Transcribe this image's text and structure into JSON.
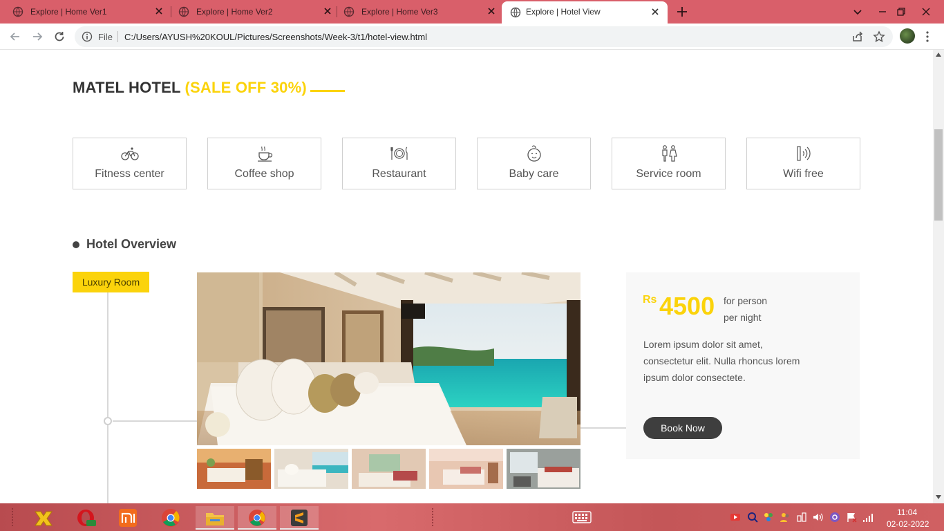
{
  "browser": {
    "tabs": [
      {
        "title": "Explore | Home Ver1",
        "active": false
      },
      {
        "title": "Explore | Home Ver2",
        "active": false
      },
      {
        "title": "Explore | Home Ver3",
        "active": false
      },
      {
        "title": "Explore | Hotel View",
        "active": true
      }
    ],
    "address": {
      "scheme_label": "File",
      "url": "C:/Users/AYUSH%20KOUL/Pictures/Screenshots/Week-3/t1/hotel-view.html"
    },
    "colors": {
      "tabbar": "#d95f6a"
    }
  },
  "page": {
    "heading": {
      "main": "MATEL HOTEL",
      "sale": "(SALE OFF 30%)"
    },
    "amenities": [
      {
        "label": "Fitness center",
        "icon": "bicycle-icon"
      },
      {
        "label": "Coffee shop",
        "icon": "coffee-cup-icon"
      },
      {
        "label": "Restaurant",
        "icon": "plate-cutlery-icon"
      },
      {
        "label": "Baby care",
        "icon": "baby-face-icon"
      },
      {
        "label": "Service room",
        "icon": "restroom-icon"
      },
      {
        "label": "Wifi free",
        "icon": "wifi-signal-icon"
      }
    ],
    "overview": {
      "title": "Hotel Overview",
      "room_tag": "Luxury Room",
      "price": {
        "currency": "Rs",
        "amount": "4500",
        "unit_line1": "for person",
        "unit_line2": "per night"
      },
      "description": "Lorem ipsum dolor sit amet, consectetur elit. Nulla rhoncus lorem ipsum dolor consectete.",
      "book_button": "Book Now"
    },
    "colors": {
      "accent": "#fbd30b",
      "button": "#3e3e3e"
    }
  },
  "taskbar": {
    "apps": [
      "game-app-icon",
      "opera-browser-icon",
      "mi-app-icon",
      "chrome-icon",
      "file-explorer-icon",
      "chrome-icon",
      "sublime-text-icon"
    ],
    "clock": {
      "time": "11:04",
      "date": "02-02-2022"
    }
  }
}
